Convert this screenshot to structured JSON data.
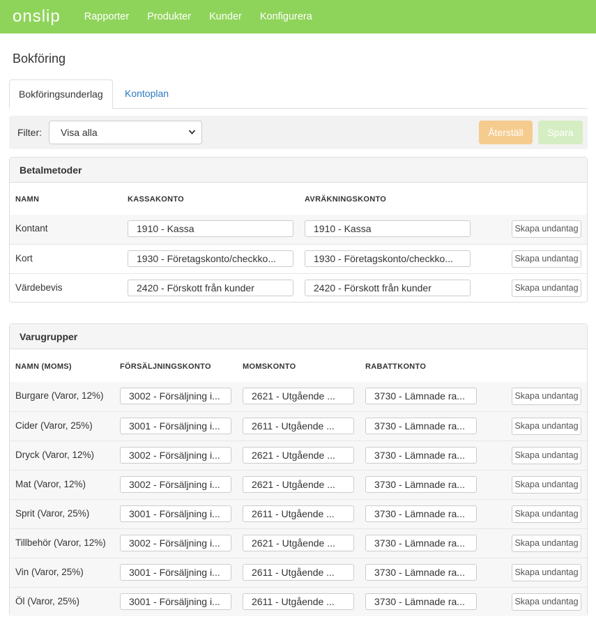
{
  "app": {
    "logo": "onslip",
    "nav": [
      "Rapporter",
      "Produkter",
      "Kunder",
      "Konfigurera"
    ]
  },
  "page_title": "Bokföring",
  "tabs": [
    {
      "label": "Bokföringsunderlag",
      "active": true
    },
    {
      "label": "Kontoplan",
      "active": false
    }
  ],
  "filter": {
    "label": "Filter:",
    "selected": "Visa alla",
    "reset_label": "Återställ",
    "save_label": "Spara"
  },
  "colors": {
    "topbar": "#8fd45a",
    "reset": "#f5cb8e",
    "save": "#d5edc2",
    "link": "#2b78c2"
  },
  "payment": {
    "title": "Betalmetoder",
    "headers": [
      "NAMN",
      "KASSAKONTO",
      "AVRÄKNINGSKONTO"
    ],
    "button_label": "Skapa undantag",
    "rows": [
      {
        "name": "Kontant",
        "kassa": "1910 - Kassa",
        "avrakning": "1910 - Kassa"
      },
      {
        "name": "Kort",
        "kassa": "1930 - Företagskonto/checkko...",
        "avrakning": "1930 - Företagskonto/checkko..."
      },
      {
        "name": "Värdebevis",
        "kassa": "2420 - Förskott från kunder",
        "avrakning": "2420 - Förskott från kunder"
      }
    ]
  },
  "groups": {
    "title": "Varugrupper",
    "headers": [
      "NAMN (MOMS)",
      "FÖRSÄLJNINGSKONTO",
      "MOMSKONTO",
      "RABATTKONTO"
    ],
    "button_label": "Skapa undantag",
    "rows": [
      {
        "name": "Burgare (Varor, 12%)",
        "sales": "3002 - Försäljning i...",
        "vat": "2621 - Utgående ...",
        "discount": "3730 - Lämnade ra..."
      },
      {
        "name": "Cider (Varor, 25%)",
        "sales": "3001 - Försäljning i...",
        "vat": "2611 - Utgående ...",
        "discount": "3730 - Lämnade ra..."
      },
      {
        "name": "Dryck (Varor, 12%)",
        "sales": "3002 - Försäljning i...",
        "vat": "2621 - Utgående ...",
        "discount": "3730 - Lämnade ra..."
      },
      {
        "name": "Mat (Varor, 12%)",
        "sales": "3002 - Försäljning i...",
        "vat": "2621 - Utgående ...",
        "discount": "3730 - Lämnade ra..."
      },
      {
        "name": "Sprit (Varor, 25%)",
        "sales": "3001 - Försäljning i...",
        "vat": "2611 - Utgående ...",
        "discount": "3730 - Lämnade ra..."
      },
      {
        "name": "Tillbehör (Varor, 12%)",
        "sales": "3002 - Försäljning i...",
        "vat": "2621 - Utgående ...",
        "discount": "3730 - Lämnade ra..."
      },
      {
        "name": "Vin (Varor, 25%)",
        "sales": "3001 - Försäljning i...",
        "vat": "2611 - Utgående ...",
        "discount": "3730 - Lämnade ra..."
      },
      {
        "name": "Öl (Varor, 25%)",
        "sales": "3001 - Försäljning i...",
        "vat": "2611 - Utgående ...",
        "discount": "3730 - Lämnade ra..."
      }
    ]
  }
}
